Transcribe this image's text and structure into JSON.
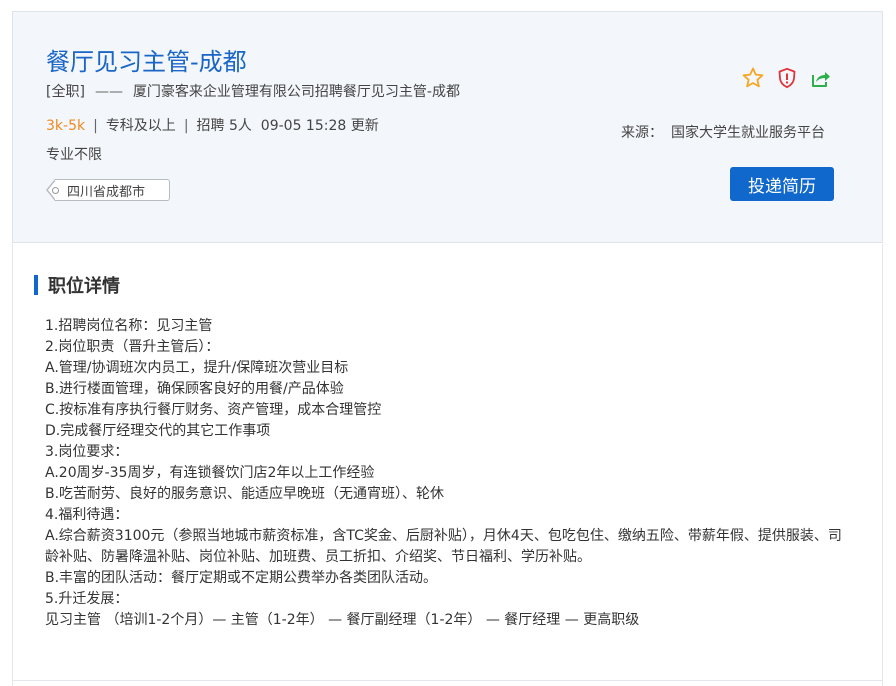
{
  "job": {
    "title": "餐厅见习主管-成都",
    "type": "[全职]",
    "dash": "——",
    "company_line": "厦门豪客来企业管理有限公司招聘餐厅见习主管-成都",
    "salary": "3k-5k",
    "education": "专科及以上",
    "hiring": "招聘 5人",
    "updated": "09-05 15:28 更新",
    "separator": "|",
    "major": "专业不限",
    "location": "四川省成都市"
  },
  "source": {
    "label": "来源：",
    "value": "国家大学生就业服务平台"
  },
  "actions": {
    "apply_label": "投递简历"
  },
  "icons": {
    "favorite": "star-icon",
    "report": "shield-alert-icon",
    "share": "share-icon"
  },
  "colors": {
    "title": "#1a66c6",
    "salary": "#f08a1c",
    "button": "#1168cc",
    "star": "#f5a623",
    "shield": "#e0333a",
    "share": "#2db04a"
  },
  "details": {
    "section_title": "职位详情",
    "lines": [
      "1.招聘岗位名称：见习主管",
      "2.岗位职责（晋升主管后）：",
      "A.管理/协调班次内员工，提升/保障班次营业目标",
      "B.进行楼面管理，确保顾客良好的用餐/产品体验",
      "C.按标准有序执行餐厅财务、资产管理，成本合理管控",
      "D.完成餐厅经理交代的其它工作事项",
      "3.岗位要求：",
      "A.20周岁-35周岁，有连锁餐饮门店2年以上工作经验",
      "B.吃苦耐劳、良好的服务意识、能适应早晚班（无通宵班）、轮休",
      "4.福利待遇：",
      "A.综合薪资3100元（参照当地城市薪资标准，含TC奖金、后厨补贴），月休4天、包吃包住、缴纳五险、带薪年假、提供服装、司龄补贴、防暑降温补贴、岗位补贴、加班费、员工折扣、介绍奖、节日福利、学历补贴。",
      "B.丰富的团队活动：餐厅定期或不定期公费举办各类团队活动。",
      "5.升迁发展：",
      "见习主管 （培训1-2个月）— 主管（1-2年） — 餐厅副经理（1-2年） — 餐厅经理 — 更高职级"
    ]
  }
}
